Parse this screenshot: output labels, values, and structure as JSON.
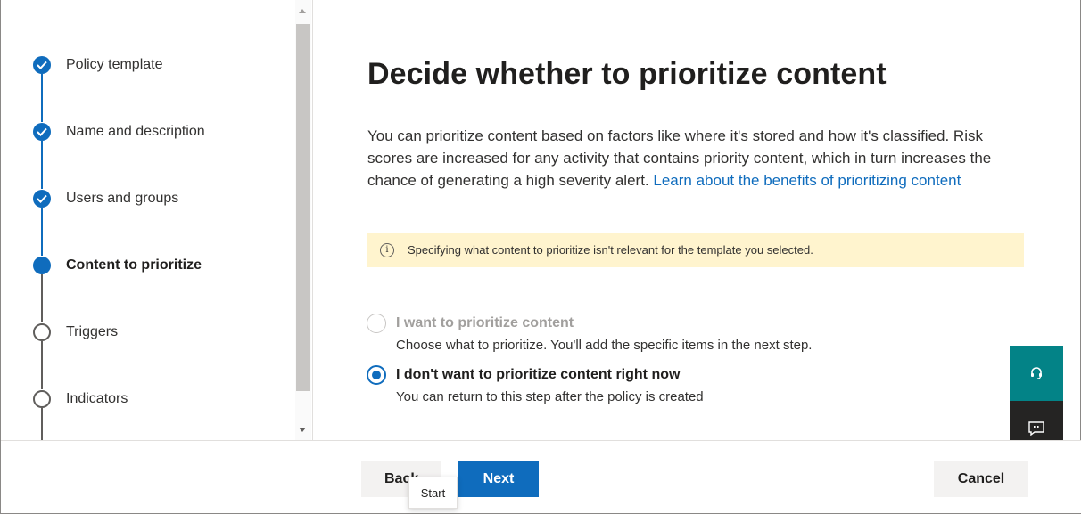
{
  "wizard": {
    "steps": [
      {
        "label": "Policy template",
        "state": "done"
      },
      {
        "label": "Name and description",
        "state": "done"
      },
      {
        "label": "Users and groups",
        "state": "done"
      },
      {
        "label": "Content to prioritize",
        "state": "current"
      },
      {
        "label": "Triggers",
        "state": "pending"
      },
      {
        "label": "Indicators",
        "state": "pending"
      }
    ]
  },
  "main": {
    "title": "Decide whether to prioritize content",
    "description": "You can prioritize content based on factors like where it's stored and how it's classified. Risk scores are increased for any activity that contains priority content, which in turn increases the chance of generating a high severity alert.",
    "learn_more_link": "Learn about the benefits of prioritizing content",
    "banner": {
      "icon": "info-icon",
      "text": "Specifying what content to prioritize isn't relevant for the template you selected."
    },
    "options": [
      {
        "title": "I want to prioritize content",
        "subtitle": "Choose what to prioritize. You'll add the specific items in the next step.",
        "selected": false,
        "disabled": true
      },
      {
        "title": "I don't want to prioritize content right now",
        "subtitle": "You can return to this step after the policy is created",
        "selected": true,
        "disabled": false
      }
    ]
  },
  "side_buttons": {
    "help_icon": "headset-icon",
    "feedback_icon": "feedback-icon"
  },
  "footer": {
    "back_label": "Back",
    "next_label": "Next",
    "cancel_label": "Cancel",
    "tooltip": "Start"
  },
  "colors": {
    "accent": "#0f6cbd",
    "banner_bg": "#fff4ce",
    "help_bg": "#038387",
    "feedback_bg": "#252423"
  }
}
